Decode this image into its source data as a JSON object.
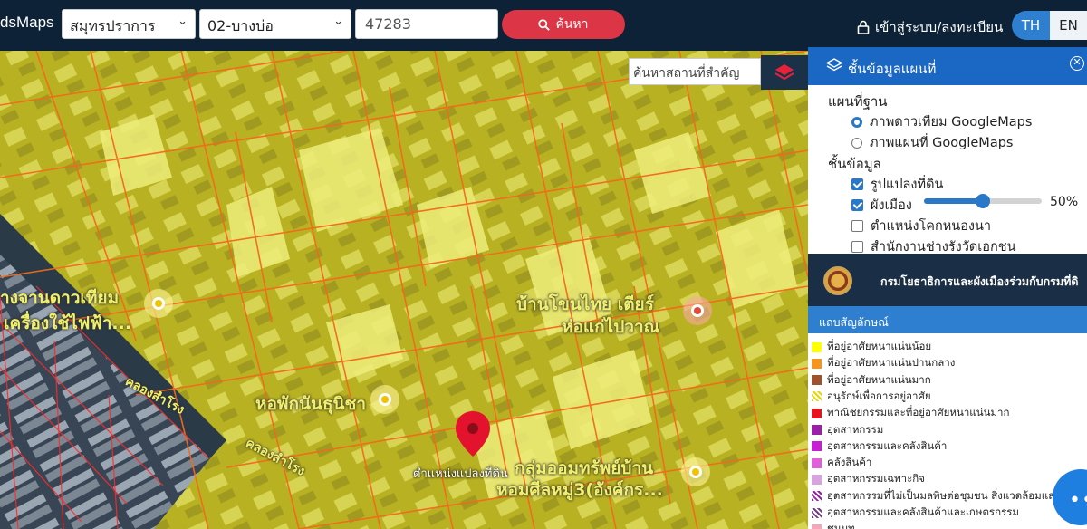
{
  "header": {
    "brand": "dsMaps",
    "province": "สมุทรปราการ",
    "district": "02-บางบ่อ",
    "parcel_number": "47283",
    "search_label": "ค้นหา",
    "login_label": "เข้าสู่ระบบ/ลงทะเบียน",
    "lang_th": "TH",
    "lang_en": "EN"
  },
  "map": {
    "place_search_placeholder": "ค้นหาสถานที่สำคัญ",
    "labels": {
      "station": "างจานดาวเทียม",
      "station2": "เครื่องใช้ไฟฟ้า...",
      "canal1": "คลองสำโรง",
      "canal2": "คลองสำโรง",
      "village": "บ้านโขนไทย เตียร์",
      "village2": "ห่อแก่ไปวาณ",
      "dorm": "หอพักนันธุนิชา",
      "fund": "กลุ่มออมทรัพย์บ้าน",
      "fund2": "หอมศีลหมู่3(อังค์กร...",
      "parcel_pin": "ตำแหน่งแปลงที่ดิน"
    }
  },
  "layer_panel": {
    "title": "ชั้นข้อมูลแผนที่",
    "base_title": "แผนที่ฐาน",
    "base_options": [
      {
        "label": "ภาพดาวเทียม GoogleMaps",
        "selected": true
      },
      {
        "label": "ภาพแผนที่ GoogleMaps",
        "selected": false
      }
    ],
    "layers_title": "ชั้นข้อมูล",
    "layers": [
      {
        "label": "รูปแปลงที่ดิน",
        "checked": true
      },
      {
        "label": "ผังเมือง",
        "checked": true
      },
      {
        "label": "ตำแหน่งโคกหนองนา",
        "checked": false
      },
      {
        "label": "สำนักงานช่างรังวัดเอกชน",
        "checked": false
      }
    ],
    "opacity_value": 50,
    "opacity_text": "50%"
  },
  "department": {
    "name": "กรมโยธาธิการและผังเมืองร่วมกับกรมที่ดิ"
  },
  "legend": {
    "title": "แถบสัญลักษณ์",
    "items": [
      {
        "label": "ที่อยู่อาศัยหนาแน่นน้อย",
        "color": "#ffff00",
        "hatch": false
      },
      {
        "label": "ที่อยู่อาศัยหนาแน่นปานกลาง",
        "color": "#f7941d",
        "hatch": false
      },
      {
        "label": "ที่อยู่อาศัยหนาแน่นมาก",
        "color": "#a0522d",
        "hatch": false
      },
      {
        "label": "อนุรักษ์เพื่อการอยู่อาศัย",
        "color": "#e8d800",
        "hatch": true
      },
      {
        "label": "พาณิชยกรรมและที่อยู่อาศัยหนาแน่นมาก",
        "color": "#e8141b",
        "hatch": false
      },
      {
        "label": "อุตสาหกรรม",
        "color": "#9b1fa8",
        "hatch": false
      },
      {
        "label": "อุตสาหกรรมและคลังสินค้า",
        "color": "#c81ed6",
        "hatch": false
      },
      {
        "label": "คลังสินค้า",
        "color": "#e15fd8",
        "hatch": false
      },
      {
        "label": "อุตสาหกรรมเฉพาะกิจ",
        "color": "#d9a3e0",
        "hatch": false
      },
      {
        "label": "อุตสาหกรรมที่ไม่เป็นมลพิษต่อชุมชน สิ่งแวดล้อมแล",
        "color": "#9b1fa8",
        "hatch": true
      },
      {
        "label": "อุตสาหกรรมและคลังสินค้าและเกษตรกรรม",
        "color": "#7a3a8a",
        "hatch": true
      },
      {
        "label": "ชนบท",
        "color": "#f4a7b9",
        "hatch": false
      }
    ]
  },
  "fab_label": "•••"
}
